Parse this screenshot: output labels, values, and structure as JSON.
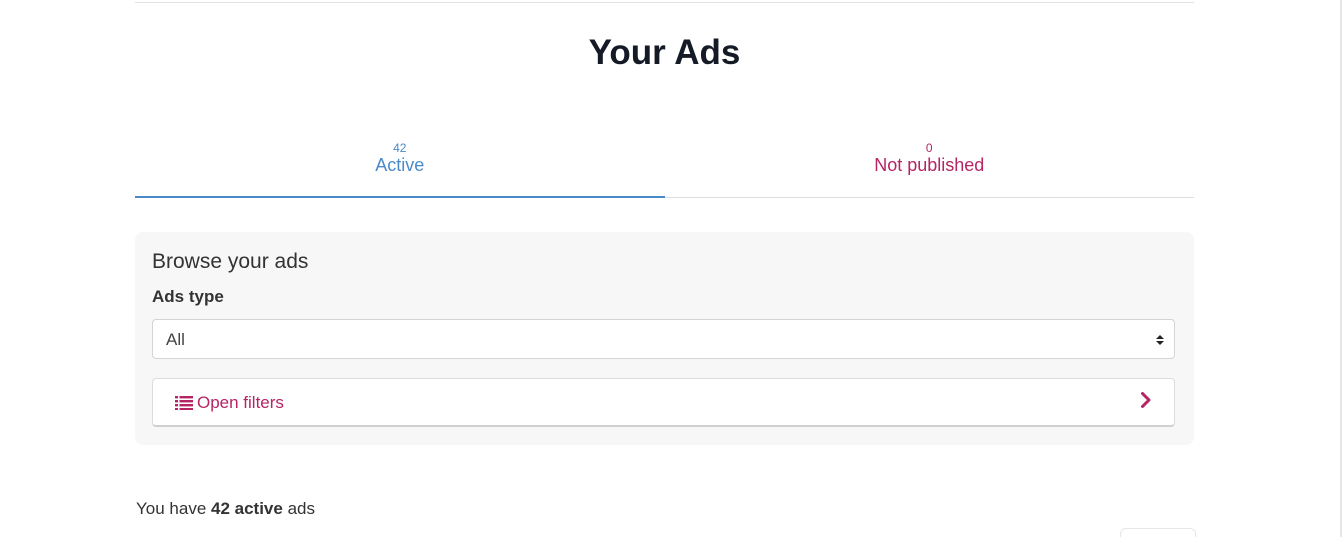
{
  "page": {
    "title": "Your Ads"
  },
  "tabs": [
    {
      "count": "42",
      "label": "Active",
      "state": "active"
    },
    {
      "count": "0",
      "label": "Not published",
      "state": "inactive"
    }
  ],
  "filters": {
    "heading": "Browse your ads",
    "ads_type_label": "Ads type",
    "ads_type_value": "All",
    "open_filters_label": "Open filters",
    "open_filters_icon": "list-icon",
    "chevron_icon": "chevron-right-icon"
  },
  "summary": {
    "prefix": "You have ",
    "highlight": "42 active",
    "suffix": " ads"
  },
  "colors": {
    "accent_blue": "#4a8ac9",
    "accent_magenta": "#b52565",
    "title": "#141a26",
    "card_bg": "#f7f7f7"
  }
}
